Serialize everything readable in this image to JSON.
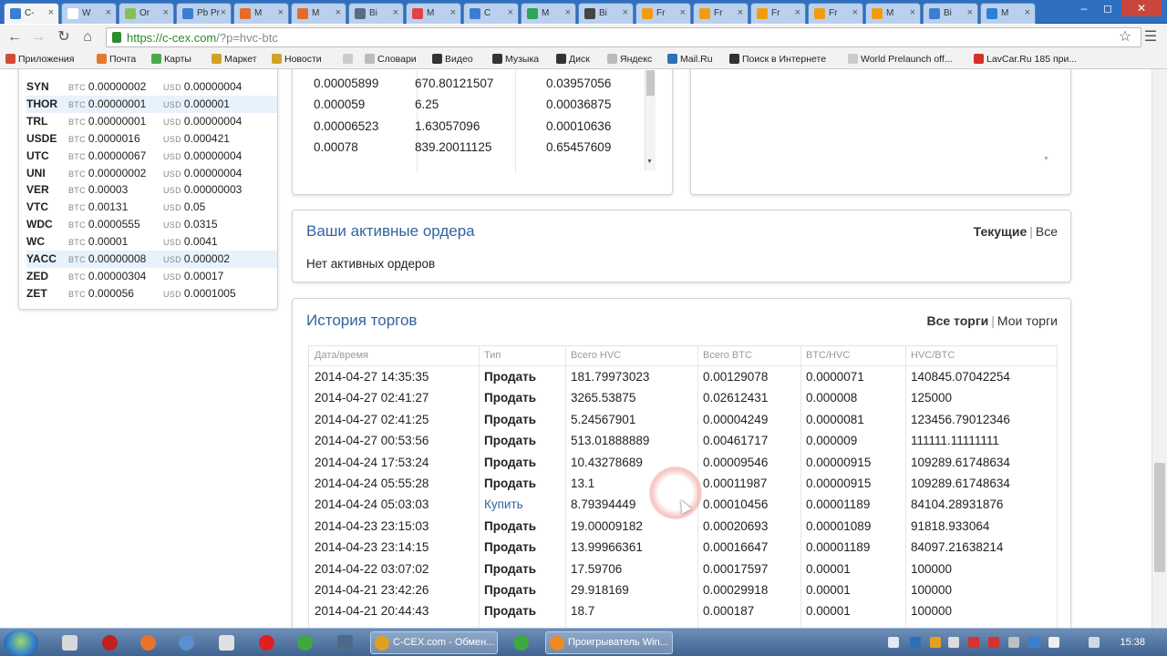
{
  "browser": {
    "tabs": [
      {
        "label": "C-",
        "fav": "#3b7ed1",
        "active": true
      },
      {
        "label": "W",
        "fav": "#ffffff",
        "active": false
      },
      {
        "label": "Or",
        "fav": "#88c057",
        "active": false
      },
      {
        "label": "Pb Pr",
        "fav": "#3b7ed1",
        "active": false
      },
      {
        "label": "M",
        "fav": "#e36c2c",
        "active": false
      },
      {
        "label": "M",
        "fav": "#e36c2c",
        "active": false
      },
      {
        "label": "Bi",
        "fav": "#5a6c80",
        "active": false
      },
      {
        "label": "M",
        "fav": "#e0444a",
        "active": false
      },
      {
        "label": "C",
        "fav": "#3b7ed1",
        "active": false
      },
      {
        "label": "M",
        "fav": "#2fa35a",
        "active": false
      },
      {
        "label": "Bi",
        "fav": "#444444",
        "active": false
      },
      {
        "label": "Fr",
        "fav": "#f39c12",
        "active": false
      },
      {
        "label": "Fr",
        "fav": "#f39c12",
        "active": false
      },
      {
        "label": "Fr",
        "fav": "#f39c12",
        "active": false
      },
      {
        "label": "Fr",
        "fav": "#f39c12",
        "active": false
      },
      {
        "label": "M",
        "fav": "#f39c12",
        "active": false
      },
      {
        "label": "Bi",
        "fav": "#3b7ed1",
        "active": false
      },
      {
        "label": "M",
        "fav": "#2d7fd6",
        "active": false
      }
    ],
    "url_host": "https://c-cex.com",
    "url_path": "/?p=hvc-btc",
    "bookmarks": [
      {
        "label": "Приложения",
        "color": "#d04a3a"
      },
      {
        "label": "Почта",
        "color": "#e8762d"
      },
      {
        "label": "Карты",
        "color": "#4aa84a"
      },
      {
        "label": "Маркет",
        "color": "#d3a125"
      },
      {
        "label": "Новости",
        "color": "#d3a125"
      },
      {
        "label": "",
        "color": "#cccccc"
      },
      {
        "label": "Словари",
        "color": "#bbbbbb"
      },
      {
        "label": "Видео",
        "color": "#333333"
      },
      {
        "label": "Музыка",
        "color": "#333333"
      },
      {
        "label": "Диск",
        "color": "#333333"
      },
      {
        "label": "Яндекс",
        "color": "#bbbbbb"
      },
      {
        "label": "Mail.Ru",
        "color": "#2d6fb8"
      },
      {
        "label": "Поиск в Интернете",
        "color": "#333333"
      },
      {
        "label": "World Prelaunch off...",
        "color": "#cccccc"
      },
      {
        "label": "LavCar.Ru 185 при...",
        "color": "#d6302a"
      }
    ]
  },
  "coin_list": {
    "btc_label": "BTC",
    "usd_label": "USD",
    "rows": [
      {
        "symbol": "SYN",
        "btc": "0.00000002",
        "usd": "0.00000004",
        "highlight": false
      },
      {
        "symbol": "THOR",
        "btc": "0.00000001",
        "usd": "0.000001",
        "highlight": true
      },
      {
        "symbol": "TRL",
        "btc": "0.00000001",
        "usd": "0.00000004",
        "highlight": false
      },
      {
        "symbol": "USDE",
        "btc": "0.0000016",
        "usd": "0.000421",
        "highlight": false
      },
      {
        "symbol": "UTC",
        "btc": "0.00000067",
        "usd": "0.00000004",
        "highlight": false
      },
      {
        "symbol": "UNI",
        "btc": "0.00000002",
        "usd": "0.00000004",
        "highlight": false
      },
      {
        "symbol": "VER",
        "btc": "0.00003",
        "usd": "0.00000003",
        "highlight": false
      },
      {
        "symbol": "VTC",
        "btc": "0.00131",
        "usd": "0.05",
        "highlight": false
      },
      {
        "symbol": "WDC",
        "btc": "0.0000555",
        "usd": "0.0315",
        "highlight": false
      },
      {
        "symbol": "WC",
        "btc": "0.00001",
        "usd": "0.0041",
        "highlight": false
      },
      {
        "symbol": "YACC",
        "btc": "0.00000008",
        "usd": "0.000002",
        "highlight": true
      },
      {
        "symbol": "ZED",
        "btc": "0.00000304",
        "usd": "0.00017",
        "highlight": false
      },
      {
        "symbol": "ZET",
        "btc": "0.000056",
        "usd": "0.0001005",
        "highlight": false
      }
    ]
  },
  "order_book": {
    "rows": [
      {
        "price": "0.00005899",
        "amount": "670.80121507",
        "total": "0.03957056"
      },
      {
        "price": "0.000059",
        "amount": "6.25",
        "total": "0.00036875"
      },
      {
        "price": "0.00006523",
        "amount": "1.63057096",
        "total": "0.00010636"
      },
      {
        "price": "0.00078",
        "amount": "839.20011125",
        "total": "0.65457609"
      }
    ]
  },
  "active_orders": {
    "title": "Ваши активные ордера",
    "filter_current": "Текущие",
    "filter_all": "Все",
    "separator": "|",
    "empty_text": "Нет активных ордеров"
  },
  "trade_history": {
    "title": "История торгов",
    "filter_all_trades": "Все торги",
    "filter_my_trades": "Мои торги",
    "separator": "|",
    "columns": [
      "Дата/время",
      "Тип",
      "Всего HVC",
      "Всего BTC",
      "BTC/HVC",
      "HVC/BTC"
    ],
    "rows": [
      {
        "date": "2014-04-27 14:35:35",
        "type": "Продать",
        "kind": "sell",
        "hvc": "181.79973023",
        "btc": "0.00129078",
        "rate": "0.0000071",
        "inv": "140845.07042254"
      },
      {
        "date": "2014-04-27 02:41:27",
        "type": "Продать",
        "kind": "sell",
        "hvc": "3265.53875",
        "btc": "0.02612431",
        "rate": "0.000008",
        "inv": "125000"
      },
      {
        "date": "2014-04-27 02:41:25",
        "type": "Продать",
        "kind": "sell",
        "hvc": "5.24567901",
        "btc": "0.00004249",
        "rate": "0.0000081",
        "inv": "123456.79012346"
      },
      {
        "date": "2014-04-27 00:53:56",
        "type": "Продать",
        "kind": "sell",
        "hvc": "513.01888889",
        "btc": "0.00461717",
        "rate": "0.000009",
        "inv": "111111.11111111"
      },
      {
        "date": "2014-04-24 17:53:24",
        "type": "Продать",
        "kind": "sell",
        "hvc": "10.43278689",
        "btc": "0.00009546",
        "rate": "0.00000915",
        "inv": "109289.61748634"
      },
      {
        "date": "2014-04-24 05:55:28",
        "type": "Продать",
        "kind": "sell",
        "hvc": "13.1",
        "btc": "0.00011987",
        "rate": "0.00000915",
        "inv": "109289.61748634"
      },
      {
        "date": "2014-04-24 05:03:03",
        "type": "Купить",
        "kind": "buy",
        "hvc": "8.79394449",
        "btc": "0.00010456",
        "rate": "0.00001189",
        "inv": "84104.28931876"
      },
      {
        "date": "2014-04-23 23:15:03",
        "type": "Продать",
        "kind": "sell",
        "hvc": "19.00009182",
        "btc": "0.00020693",
        "rate": "0.00001089",
        "inv": "91818.933064"
      },
      {
        "date": "2014-04-23 23:14:15",
        "type": "Продать",
        "kind": "sell",
        "hvc": "13.99966361",
        "btc": "0.00016647",
        "rate": "0.00001189",
        "inv": "84097.21638214"
      },
      {
        "date": "2014-04-22 03:07:02",
        "type": "Продать",
        "kind": "sell",
        "hvc": "17.59706",
        "btc": "0.00017597",
        "rate": "0.00001",
        "inv": "100000"
      },
      {
        "date": "2014-04-21 23:42:26",
        "type": "Продать",
        "kind": "sell",
        "hvc": "29.918169",
        "btc": "0.00029918",
        "rate": "0.00001",
        "inv": "100000"
      },
      {
        "date": "2014-04-21 20:44:43",
        "type": "Продать",
        "kind": "sell",
        "hvc": "18.7",
        "btc": "0.000187",
        "rate": "0.00001",
        "inv": "100000"
      }
    ]
  },
  "taskbar": {
    "tasks": [
      {
        "label": "C-CEX.com - Обмен...",
        "color": "#e0a020"
      },
      {
        "label": "Проигрыватель Win...",
        "color": "#f08a20"
      }
    ],
    "clock": "15:38"
  },
  "colors": {
    "accent": "#2f64a0",
    "sell": "#222222",
    "buy": "#2f64a0",
    "highlight_row": "#e8f2fc"
  }
}
